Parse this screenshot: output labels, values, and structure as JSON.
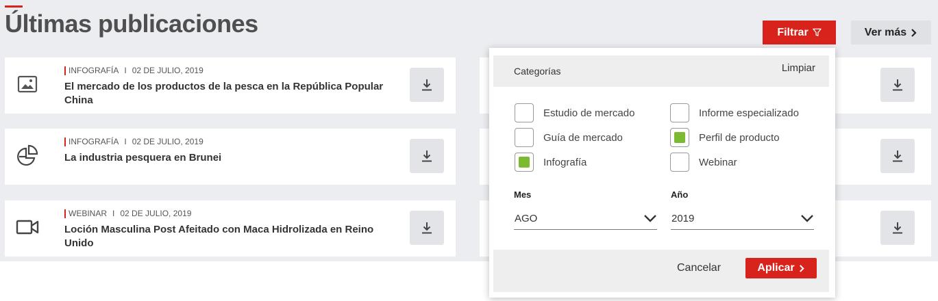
{
  "page": {
    "title": "Últimas publicaciones",
    "filter_label": "Filtrar",
    "more_label": "Ver más"
  },
  "publications": [
    {
      "type": "INFOGRAFÍA",
      "separator": "I",
      "date": "02 DE JULIO, 2019",
      "title": "El mercado de los productos de la pesca en la República Popular China",
      "icon": "image-icon"
    },
    {
      "type": "INFOGRAFÍA",
      "separator": "I",
      "date": "02 DE JULIO, 2019",
      "title": "La industria pesquera en Brunei",
      "icon": "pie-chart-icon"
    },
    {
      "type": "WEBINAR",
      "separator": "I",
      "date": "02 DE JULIO, 2019",
      "title": "Loción Masculina Post Afeitado con Maca Hidrolizada en Reino Unido",
      "icon": "video-camera-icon"
    }
  ],
  "filter_panel": {
    "categories_label": "Categorías",
    "clear_label": "Limpiar",
    "categories": [
      {
        "label": "Estudio de mercado",
        "checked": false
      },
      {
        "label": "Informe especializado",
        "checked": false
      },
      {
        "label": "Guía de mercado",
        "checked": false
      },
      {
        "label": "Perfil de producto",
        "checked": true
      },
      {
        "label": "Infografía",
        "checked": true
      },
      {
        "label": "Webinar",
        "checked": false
      }
    ],
    "month_label": "Mes",
    "month_value": "AGO",
    "year_label": "Año",
    "year_value": "2019",
    "cancel_label": "Cancelar",
    "apply_label": "Aplicar"
  },
  "colors": {
    "accent": "#d8231c",
    "checked": "#7cba2f",
    "background": "#ebedf0"
  }
}
